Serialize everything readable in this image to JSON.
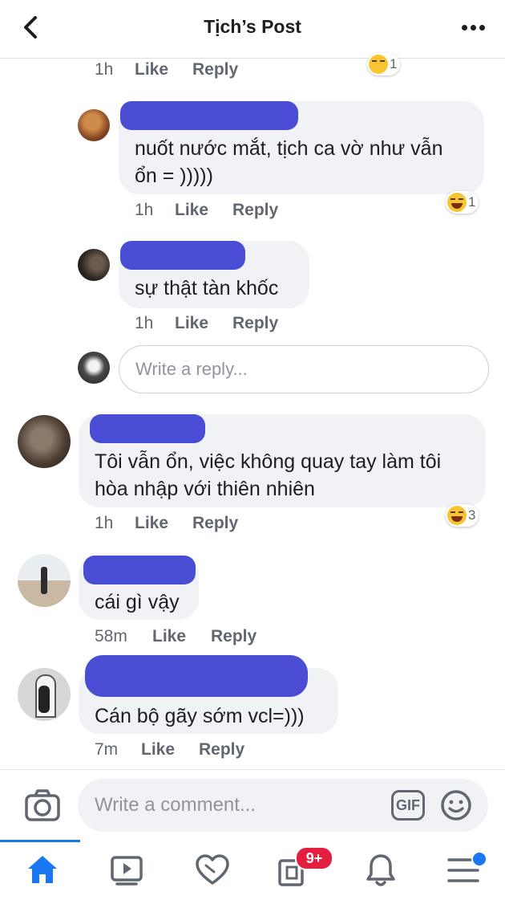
{
  "header": {
    "title": "Tịch’s Post"
  },
  "top_fragment": {
    "time": "1h",
    "like": "Like",
    "reply": "Reply",
    "reaction_count": "1"
  },
  "replies": [
    {
      "text_line1": "nuốt nước mắt, tịch ca vờ như vẫn",
      "text_line2": "ổn = )))))",
      "time": "1h",
      "like": "Like",
      "reply": "Reply",
      "reaction_count": "1"
    },
    {
      "text_line1": "sự thật tàn khốc",
      "time": "1h",
      "like": "Like",
      "reply": "Reply"
    }
  ],
  "reply_input": {
    "placeholder": "Write a reply..."
  },
  "comments": [
    {
      "text_line1": "Tôi vẫn ổn, việc không quay tay làm tôi",
      "text_line2": "hòa nhập với thiên nhiên",
      "time": "1h",
      "like": "Like",
      "reply": "Reply",
      "reaction_count": "3"
    },
    {
      "text_line1": "cái gì vậy",
      "time": "58m",
      "like": "Like",
      "reply": "Reply"
    },
    {
      "text_line1": "Cán bộ gãy sớm vcl=)))",
      "time": "7m",
      "like": "Like",
      "reply": "Reply"
    }
  ],
  "composer": {
    "placeholder": "Write a comment...",
    "gif_label": "GIF"
  },
  "tabbar": {
    "notifications_badge": "9+"
  },
  "colors": {
    "accent": "#1877f2",
    "badge": "#e41e3f",
    "redaction": "#3a3fd0"
  },
  "icons": [
    "back-arrow-icon",
    "more-dots-icon",
    "camera-icon",
    "gif-icon",
    "smiley-icon",
    "home-icon",
    "video-icon",
    "dating-heart-icon",
    "groups-icon",
    "bell-icon",
    "menu-icon"
  ]
}
